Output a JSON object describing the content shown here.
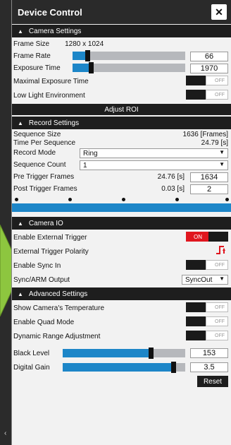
{
  "window": {
    "title": "Device Control",
    "close_label": "✕"
  },
  "camera_settings": {
    "header": "Camera Settings",
    "frame_size_label": "Frame Size",
    "frame_size_value": "1280 x 1024",
    "frame_rate_label": "Frame Rate",
    "frame_rate_value": "66",
    "frame_rate_level": 0.13,
    "exposure_label": "Exposure Time",
    "exposure_value": "1970",
    "exposure_level": 0.16,
    "max_exposure_label": "Maximal Exposure Time",
    "max_exposure_state": "OFF",
    "low_light_label": "Low Light Environment",
    "low_light_state": "OFF",
    "adjust_roi_label": "Adjust ROI"
  },
  "record_settings": {
    "header": "Record Settings",
    "sequence_size_label": "Sequence Size",
    "sequence_size_value": "1636 [Frames]",
    "time_per_seq_label": "Time Per Sequence",
    "time_per_seq_value": "24.79 [s]",
    "record_mode_label": "Record Mode",
    "record_mode_value": "Ring",
    "sequence_count_label": "Sequence Count",
    "sequence_count_value": "1",
    "pre_trigger_label": "Pre Trigger Frames",
    "pre_trigger_time": "24.76 [s]",
    "pre_trigger_value": "1634",
    "post_trigger_label": "Post Trigger Frames",
    "post_trigger_time": "0.03 [s]",
    "post_trigger_value": "2"
  },
  "camera_io": {
    "header": "Camera IO",
    "ext_trigger_label": "Enable External Trigger",
    "ext_trigger_state": "ON",
    "ext_polarity_label": "External Trigger Polarity",
    "polarity_icon": "rising-edge-icon",
    "sync_in_label": "Enable Sync In",
    "sync_in_state": "OFF",
    "sync_out_label": "Sync/ARM Output",
    "sync_out_value": "SyncOut"
  },
  "advanced_settings": {
    "header": "Advanced Settings",
    "show_temp_label": "Show Camera's Temperature",
    "show_temp_state": "OFF",
    "quad_mode_label": "Enable Quad Mode",
    "quad_mode_state": "OFF",
    "dynamic_range_label": "Dynamic Range Adjustment",
    "dynamic_range_state": "OFF",
    "black_level_label": "Black Level",
    "black_level_value": "153",
    "black_level_level": 0.72,
    "digital_gain_label": "Digital Gain",
    "digital_gain_value": "3.5",
    "digital_gain_level": 0.9,
    "reset_label": "Reset"
  },
  "colors": {
    "accent_blue": "#1d86c8",
    "on_red": "#e0161e",
    "header_dark": "#1e1e1e",
    "arrow_green": "#8dc63f"
  }
}
